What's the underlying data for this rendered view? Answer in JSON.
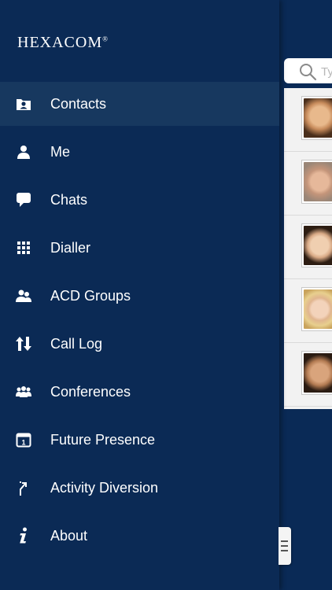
{
  "app": {
    "logo": "HEXACOM",
    "logo_mark": "®"
  },
  "menu": [
    {
      "label": "Contacts",
      "icon": "contact-card-icon",
      "selected": true
    },
    {
      "label": "Me",
      "icon": "person-icon",
      "selected": false
    },
    {
      "label": "Chats",
      "icon": "chat-bubble-icon",
      "selected": false
    },
    {
      "label": "Dialler",
      "icon": "keypad-icon",
      "selected": false
    },
    {
      "label": "ACD Groups",
      "icon": "group-icon",
      "selected": false
    },
    {
      "label": "Call Log",
      "icon": "up-down-arrows-icon",
      "selected": false
    },
    {
      "label": "Conferences",
      "icon": "conference-icon",
      "selected": false
    },
    {
      "label": "Future Presence",
      "icon": "calendar-icon",
      "selected": false
    },
    {
      "label": "Activity Diversion",
      "icon": "diversion-icon",
      "selected": false
    },
    {
      "label": "About",
      "icon": "info-icon",
      "selected": false
    }
  ],
  "search": {
    "placeholder": "Ty"
  },
  "contacts": [
    {
      "avatar": "contact-avatar-1"
    },
    {
      "avatar": "contact-avatar-2"
    },
    {
      "avatar": "contact-avatar-3"
    },
    {
      "avatar": "contact-avatar-4"
    },
    {
      "avatar": "contact-avatar-5"
    }
  ],
  "colors": {
    "drawer_bg": "#0b2a55",
    "selected_bg": "#17385f",
    "text": "#ffffff"
  }
}
